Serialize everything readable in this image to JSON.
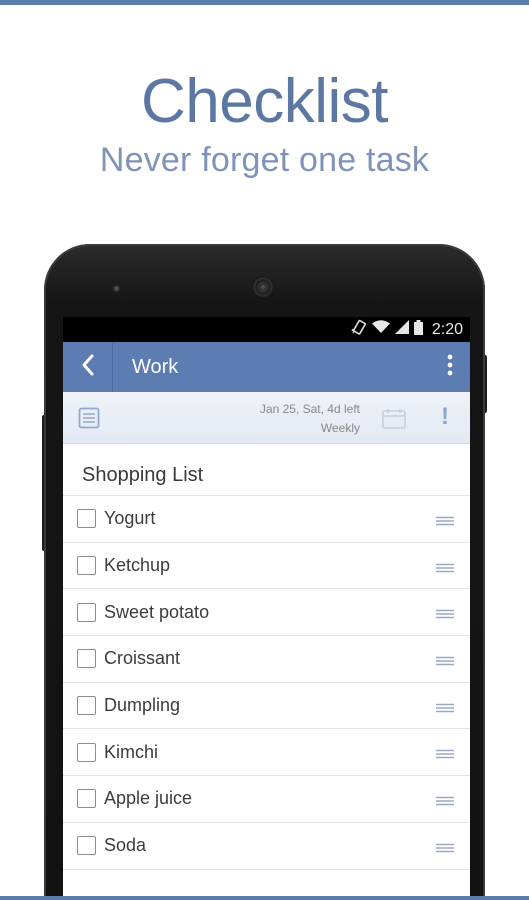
{
  "promo": {
    "title": "Checklist",
    "subtitle": "Never forget one task"
  },
  "status_bar": {
    "time": "2:20",
    "icons": [
      "vibrate-icon",
      "wifi-icon",
      "signal-icon",
      "battery-icon"
    ]
  },
  "app_bar": {
    "title": "Work",
    "back_icon": "chevron-left-icon",
    "menu_icon": "overflow-menu-icon"
  },
  "info_bar": {
    "due_date": "Jan 25, Sat, 4d left",
    "repeat": "Weekly",
    "priority_symbol": "!"
  },
  "list": {
    "title": "Shopping List",
    "items": [
      {
        "label": "Yogurt",
        "checked": false
      },
      {
        "label": "Ketchup",
        "checked": false
      },
      {
        "label": "Sweet potato",
        "checked": false
      },
      {
        "label": "Croissant",
        "checked": false
      },
      {
        "label": "Dumpling",
        "checked": false
      },
      {
        "label": "Kimchi",
        "checked": false
      },
      {
        "label": "Apple juice",
        "checked": false
      },
      {
        "label": "Soda",
        "checked": false
      }
    ]
  },
  "colors": {
    "accent": "#5d7cb2",
    "promo_text": "#5d77a3",
    "stripe": "#5c7aaa"
  }
}
